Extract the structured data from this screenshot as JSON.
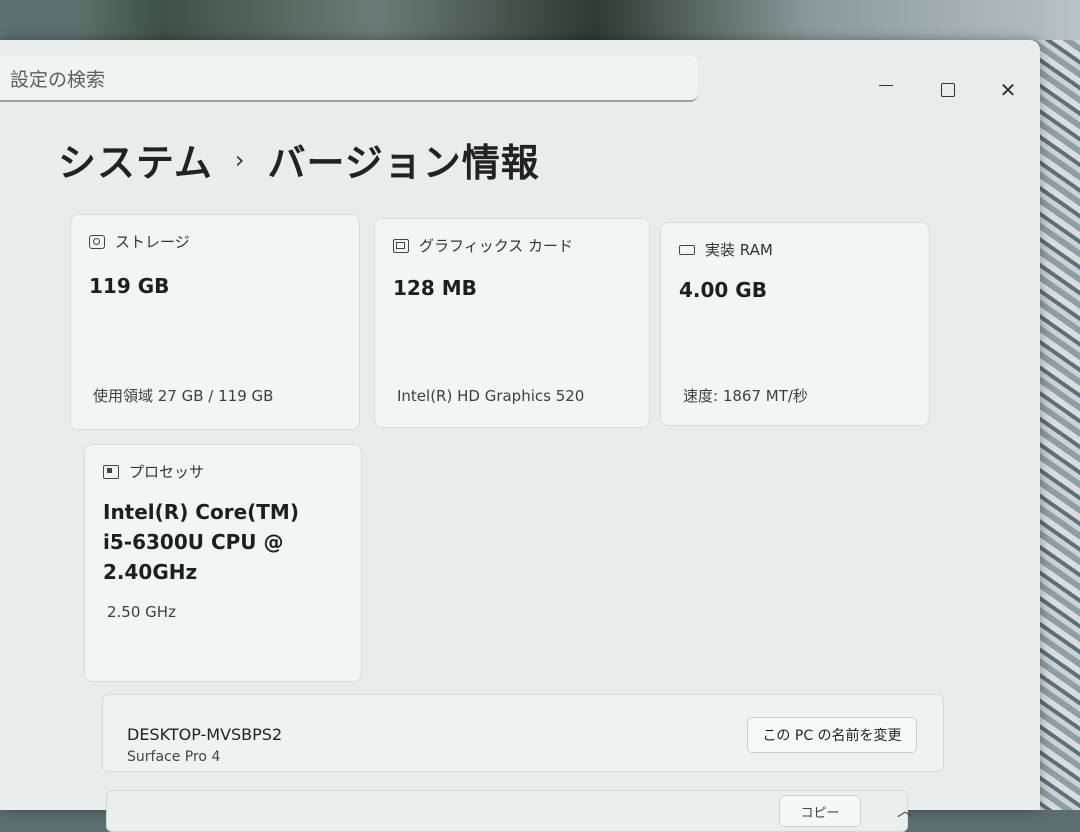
{
  "search": {
    "placeholder": "設定の検索"
  },
  "breadcrumb": {
    "parent": "システム",
    "separator": "›",
    "current": "バージョン情報"
  },
  "cards": {
    "storage": {
      "label": "ストレージ",
      "value": "119 GB",
      "sub": "使用領域 27 GB / 119 GB",
      "icon": "storage-icon"
    },
    "gpu": {
      "label": "グラフィックス カード",
      "value": "128 MB",
      "sub": "Intel(R) HD Graphics 520",
      "icon": "graphics-card-icon"
    },
    "ram": {
      "label": "実装 RAM",
      "value": "4.00 GB",
      "sub": "速度: 1867 MT/秒",
      "icon": "ram-icon"
    },
    "cpu": {
      "label": "プロセッサ",
      "value": "Intel(R) Core(TM) i5-6300U CPU @ 2.40GHz",
      "sub": "2.50 GHz",
      "icon": "processor-icon"
    }
  },
  "device": {
    "name": "DESKTOP-MVSBPS2",
    "model": "Surface Pro 4",
    "rename_label": "この PC の名前を変更"
  },
  "next_row": {
    "copy_label": "コピー"
  },
  "window_controls": {
    "minimize": "minimize-icon",
    "maximize": "maximize-icon",
    "close": "close-icon"
  }
}
